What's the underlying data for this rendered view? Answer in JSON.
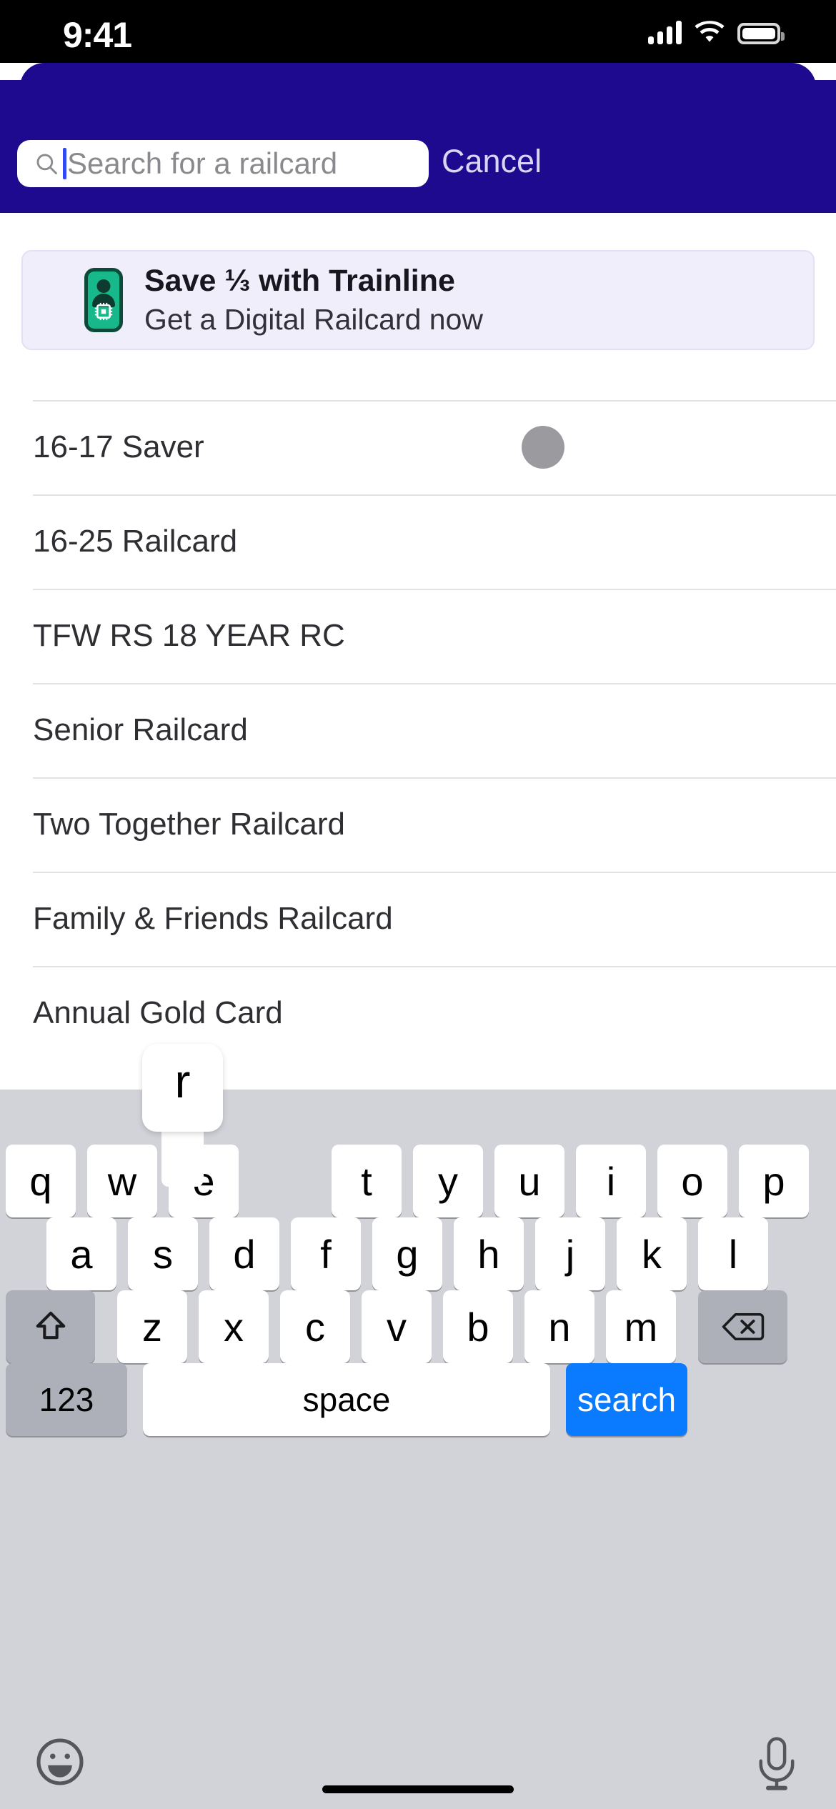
{
  "status_bar": {
    "time": "9:41",
    "icons": [
      "cellular-signal-icon",
      "wifi-icon",
      "battery-icon"
    ]
  },
  "search_header": {
    "background_color": "#1e0a8f",
    "search_icon": "search-icon",
    "placeholder": "Search for a railcard",
    "value": "",
    "cancel_label": "Cancel"
  },
  "promo_banner": {
    "icon": "digital-railcard-icon",
    "icon_color": "#17b98a",
    "background_color": "#f1eefb",
    "title": "Save ⅓ with Trainline",
    "subtitle": "Get a Digital Railcard now"
  },
  "railcard_list": {
    "rows": [
      {
        "label": "16-17 Saver",
        "has_spinner": true
      },
      {
        "label": "16-25 Railcard",
        "has_spinner": false
      },
      {
        "label": "TFW RS 18 YEAR RC",
        "has_spinner": false
      },
      {
        "label": "Senior Railcard",
        "has_spinner": false
      },
      {
        "label": "Two Together Railcard",
        "has_spinner": false
      },
      {
        "label": "Family & Friends Railcard",
        "has_spinner": false
      },
      {
        "label": "Annual Gold Card",
        "has_spinner": false
      }
    ]
  },
  "keyboard": {
    "popup_key": "r",
    "row1": [
      "q",
      "w",
      "e",
      "r",
      "t",
      "y",
      "u",
      "i",
      "o",
      "p"
    ],
    "row2": [
      "a",
      "s",
      "d",
      "f",
      "g",
      "h",
      "j",
      "k",
      "l"
    ],
    "row3_letters": [
      "z",
      "x",
      "c",
      "v",
      "b",
      "n",
      "m"
    ],
    "shift_icon": "shift-arrow-icon",
    "backspace_icon": "backspace-icon",
    "numbers_label": "123",
    "space_label": "space",
    "return_label": "search",
    "return_color": "#0a7aff",
    "emoji_icon": "emoji-smiley-icon",
    "dictation_icon": "microphone-icon"
  }
}
